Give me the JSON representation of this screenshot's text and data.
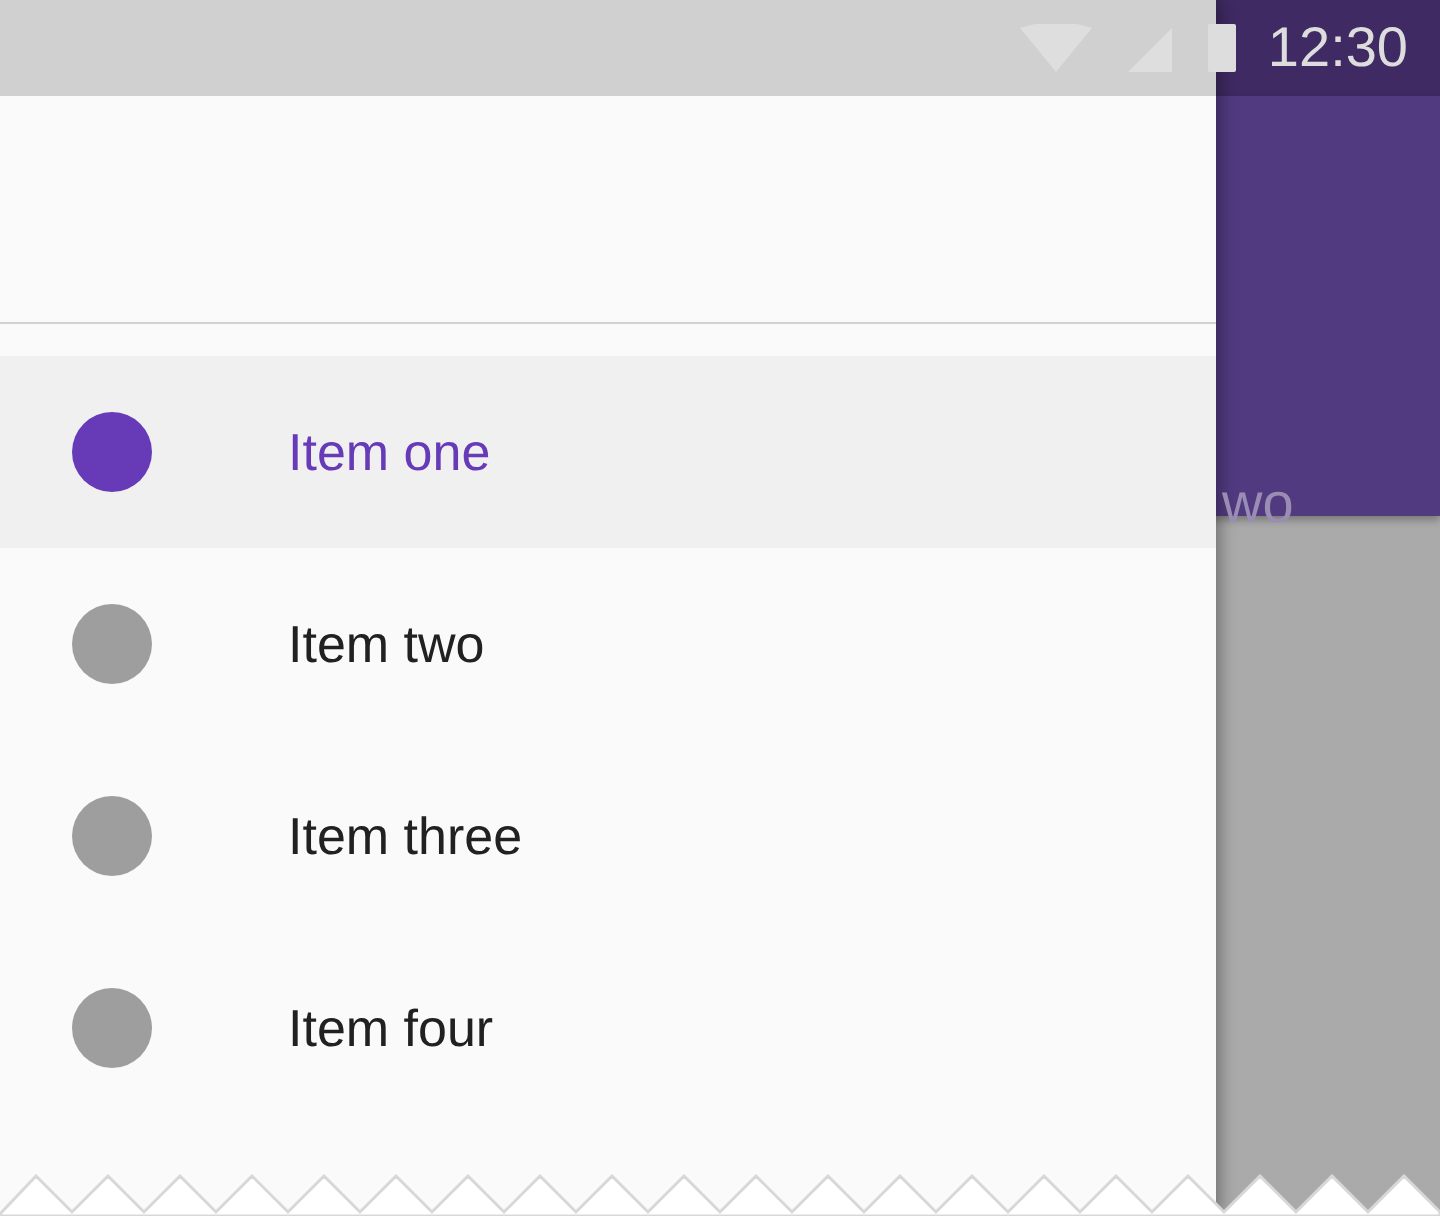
{
  "status_bar": {
    "time": "12:30"
  },
  "app_bar": {
    "tab_text": "wo"
  },
  "drawer": {
    "items": [
      {
        "label": "Item one",
        "selected": true
      },
      {
        "label": "Item two",
        "selected": false
      },
      {
        "label": "Item three",
        "selected": false
      },
      {
        "label": "Item four",
        "selected": false
      }
    ]
  }
}
